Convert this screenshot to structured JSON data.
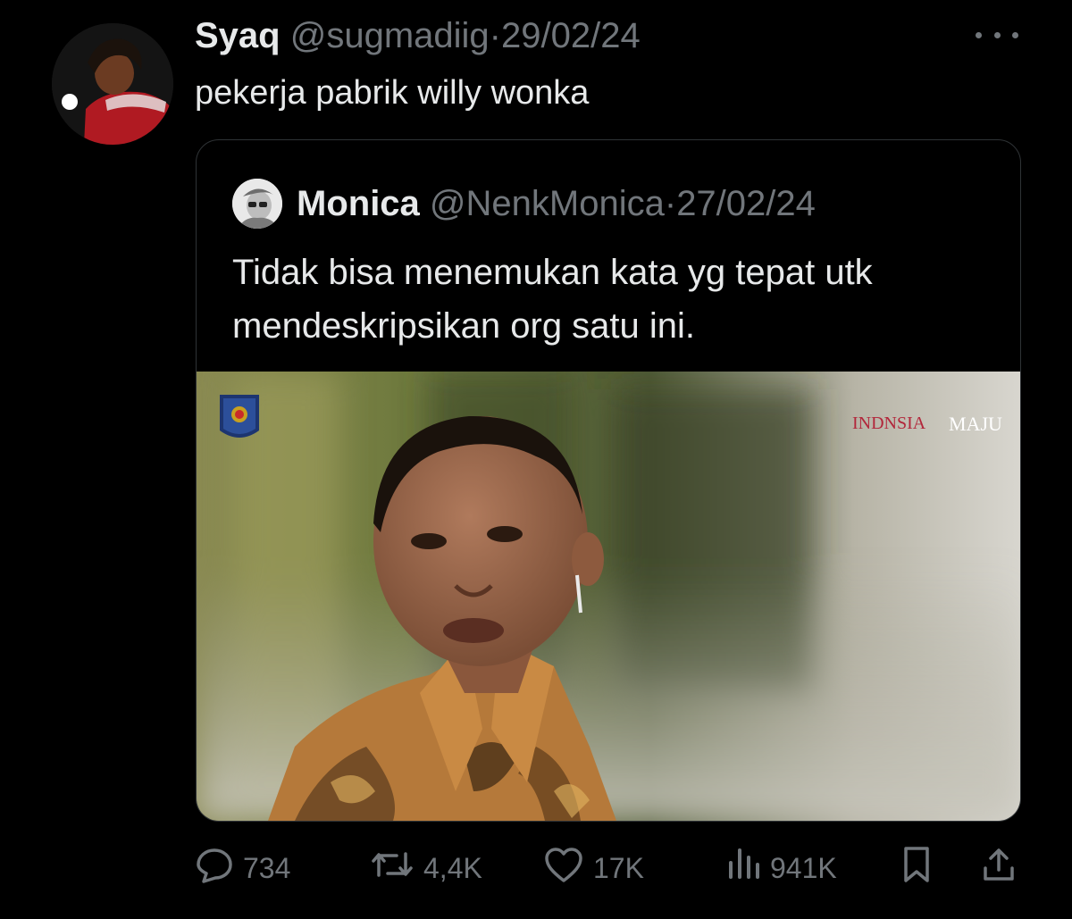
{
  "tweet": {
    "display_name": "Syaq",
    "handle": "@sugmadiig",
    "separator": "·",
    "date": "29/02/24",
    "text": "pekerja pabrik willy wonka"
  },
  "quote": {
    "display_name": "Monica",
    "handle": "@NenkMonica",
    "separator": "·",
    "date": "27/02/24",
    "text": "Tidak bisa menemukan kata yg tepat utk mendeskripsikan org satu ini.",
    "media": {
      "watermark_left": "INDNSIA",
      "watermark_right": "MAJU"
    }
  },
  "actions": {
    "replies": "734",
    "reposts": "4,4K",
    "likes": "17K",
    "views": "941K"
  },
  "icons": {
    "more": "more-horizontal-icon",
    "reply": "reply-bubble-icon",
    "repost": "repost-icon",
    "like": "heart-icon",
    "views": "analytics-bars-icon",
    "bookmark": "bookmark-icon",
    "share": "share-upload-icon"
  },
  "colors": {
    "background": "#000000",
    "text_primary": "#e7e9ea",
    "text_secondary": "#71767b",
    "border": "#2f3336"
  }
}
